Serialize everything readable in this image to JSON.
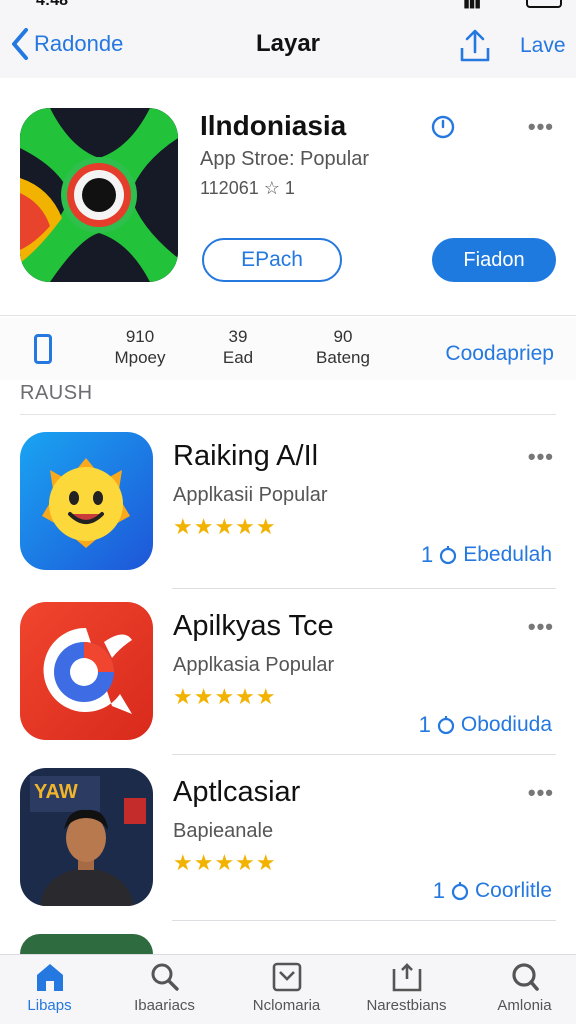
{
  "status": {
    "time": "4:48"
  },
  "nav": {
    "back_label": "Radonde",
    "title": "Layar",
    "right_label": "Lave"
  },
  "featured": {
    "title": "Ilndoniasia",
    "subtitle": "App Stroe: Popular",
    "meta": "112061 ☆ 1",
    "button_outline": "EPach",
    "button_filled": "Fiadon",
    "more": "•••"
  },
  "stats": [
    {
      "value": "910",
      "label": "Mpoey"
    },
    {
      "value": "39",
      "label": "Ead"
    },
    {
      "value": "90",
      "label": "Bateng"
    }
  ],
  "stats_link": "Coodapriep",
  "section_label": "RAUSH",
  "apps": [
    {
      "name": "Raiking A/Il",
      "category": "Applkasii Popular",
      "stars": "★★★★★",
      "rating": 5,
      "count": "1",
      "action": "Ebedulah",
      "more": "•••"
    },
    {
      "name": "Apilkyas Tce",
      "category": "Applkasia Popular",
      "stars": "★★★★★",
      "rating": 5,
      "count": "1",
      "action": "Obodiuda",
      "more": "•••"
    },
    {
      "name": "Aptlcasiar",
      "category": "Bapieanale",
      "stars": "★★★★★",
      "rating": 5,
      "count": "1",
      "action": "Coorlitle",
      "more": "•••"
    }
  ],
  "tabs": [
    {
      "label": "Libaps",
      "icon": "home-icon",
      "active": true
    },
    {
      "label": "Ibaariacs",
      "icon": "search-icon"
    },
    {
      "label": "Nclomaria",
      "icon": "inbox-icon"
    },
    {
      "label": "Narestbians",
      "icon": "tray-icon"
    },
    {
      "label": "Amlonia",
      "icon": "magnifier-icon"
    }
  ],
  "colors": {
    "accent": "#2478e0",
    "star": "#f2b300",
    "background": "#f6f6f8"
  }
}
